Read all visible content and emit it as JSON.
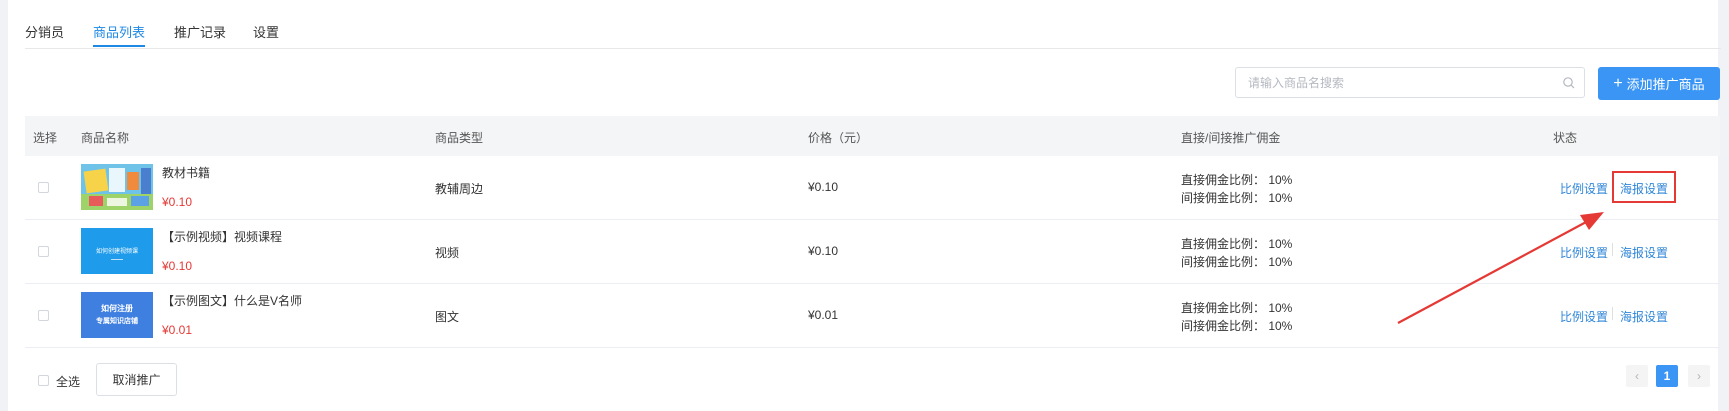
{
  "tabs": [
    "分销员",
    "商品列表",
    "推广记录",
    "设置"
  ],
  "active_tab": 1,
  "search": {
    "placeholder": "请输入商品名搜索",
    "icon": "search-icon"
  },
  "add_button": {
    "label": "添加推广商品",
    "icon": "plus-icon"
  },
  "table": {
    "headers": {
      "select": "选择",
      "name": "商品名称",
      "type": "商品类型",
      "price": "价格（元）",
      "commission": "直接/间接推广佣金",
      "status": "状态"
    },
    "rows": [
      {
        "name": "教材书籍",
        "price": "¥0.10",
        "type": "教辅周边",
        "cost": "¥0.10",
        "commission_direct": "直接佣金比例： 10%",
        "commission_indirect": "间接佣金比例： 10%",
        "action_ratio": "比例设置",
        "action_poster": "海报设置",
        "thumbnail": "textbook-thumbnail"
      },
      {
        "name": "【示例视频】视频课程",
        "price": "¥0.10",
        "type": "视频",
        "cost": "¥0.10",
        "commission_direct": "直接佣金比例： 10%",
        "commission_indirect": "间接佣金比例： 10%",
        "action_ratio": "比例设置",
        "action_poster": "海报设置",
        "thumbnail": "video-course-thumbnail",
        "thumbnail_text": "如何创建视频课"
      },
      {
        "name": "【示例图文】什么是V名师",
        "price": "¥0.01",
        "type": "图文",
        "cost": "¥0.01",
        "commission_direct": "直接佣金比例： 10%",
        "commission_indirect": "间接佣金比例： 10%",
        "action_ratio": "比例设置",
        "action_poster": "海报设置",
        "thumbnail": "article-thumbnail",
        "thumbnail_text_1": "如何注册",
        "thumbnail_text_2": "专属知识店铺"
      }
    ]
  },
  "footer": {
    "select_all": "全选",
    "cancel_button": "取消推广"
  },
  "pagination": {
    "current": "1",
    "prev_icon": "chevron-left-icon",
    "next_icon": "chevron-right-icon"
  },
  "colors": {
    "accent": "#3a95f5",
    "link": "#2f86d8",
    "price_red": "#e53935",
    "annotation_red": "#e53935"
  }
}
